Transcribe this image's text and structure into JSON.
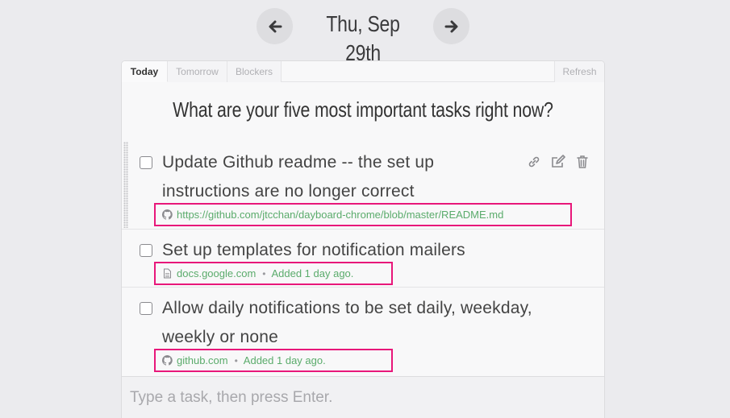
{
  "header": {
    "date": "Thu, Sep 29th",
    "prev_icon": "arrow-left-icon",
    "next_icon": "arrow-right-icon"
  },
  "tabs": {
    "today": "Today",
    "tomorrow": "Tomorrow",
    "blockers": "Blockers",
    "refresh": "Refresh"
  },
  "question": "What are your five most important tasks right now?",
  "tasks": [
    {
      "text": "Update Github readme -- the set up instructions are no longer correct",
      "source_icon": "github-icon",
      "link": "https://github.com/jtcchan/dayboard-chrome/blob/master/README.md",
      "added": ""
    },
    {
      "text": "Set up templates for notification mailers",
      "source_icon": "document-icon",
      "link": "docs.google.com",
      "added": "Added 1 day ago."
    },
    {
      "text": "Allow daily notifications to be set daily, weekday, weekly or none",
      "source_icon": "github-icon",
      "link": "github.com",
      "added": "Added 1 day ago."
    }
  ],
  "actions": {
    "link_icon": "link-icon",
    "edit_icon": "edit-icon",
    "delete_icon": "trash-icon"
  },
  "new_task": {
    "placeholder": "Type a task, then press Enter.",
    "value": ""
  },
  "colors": {
    "accent_link": "#5aab6b",
    "highlight_box": "#e8177a",
    "background": "#ebebee"
  }
}
